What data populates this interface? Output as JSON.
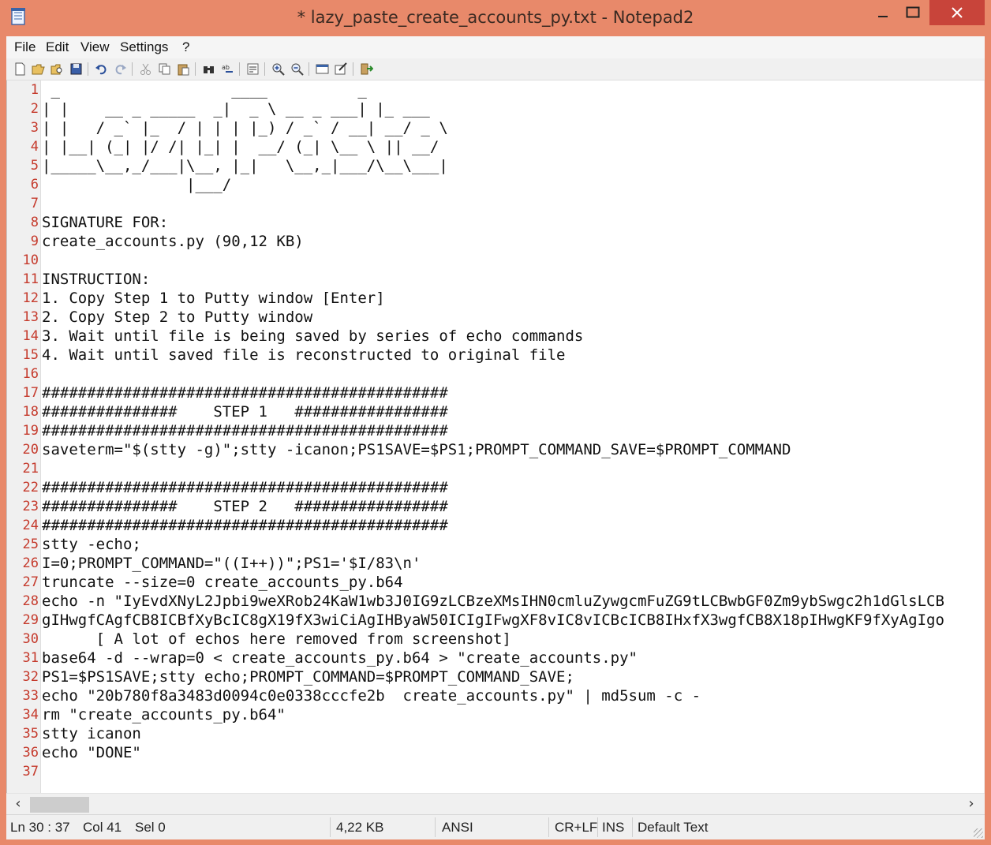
{
  "window": {
    "title": "* lazy_paste_create_accounts_py.txt - Notepad2"
  },
  "menu": [
    "File",
    "Edit",
    "View",
    "Settings",
    "?"
  ],
  "toolbar": {
    "icons": [
      "new-icon",
      "open-icon",
      "browse-icon",
      "save-icon",
      "undo-icon",
      "redo-icon",
      "cut-icon",
      "copy-icon",
      "paste-icon",
      "find-icon",
      "replace-icon",
      "word-wrap-icon",
      "zoom-in-icon",
      "zoom-out-icon",
      "scheme-icon",
      "customize-icon",
      "exit-icon"
    ]
  },
  "editor": {
    "lines": [
      " _                   ____          _",
      "| |    __ _ _____  _|  _ \\ __ _ ___| |_ ___",
      "| |   / _` |_  / | | | |_) / _` / __| __/ _ \\",
      "| |__| (_| |/ /| |_| |  __/ (_| \\__ \\ || __/",
      "|_____\\__,_/___|\\__, |_|   \\__,_|___/\\__\\___|",
      "                |___/",
      "",
      "SIGNATURE FOR:",
      "create_accounts.py (90,12 KB)",
      "",
      "INSTRUCTION:",
      "1. Copy Step 1 to Putty window [Enter]",
      "2. Copy Step 2 to Putty window",
      "3. Wait until file is being saved by series of echo commands",
      "4. Wait until saved file is reconstructed to original file",
      "",
      "#############################################",
      "###############    STEP 1   #################",
      "#############################################",
      "saveterm=\"$(stty -g)\";stty -icanon;PS1SAVE=$PS1;PROMPT_COMMAND_SAVE=$PROMPT_COMMAND",
      "",
      "#############################################",
      "###############    STEP 2   #################",
      "#############################################",
      "stty -echo;",
      "I=0;PROMPT_COMMAND=\"((I++))\";PS1='$I/83\\n'",
      "truncate --size=0 create_accounts_py.b64",
      "echo -n \"IyEvdXNyL2Jpbi9weXRob24KaW1wb3J0IG9zLCBzeXMsIHN0cmluZywgcmFuZG9tLCBwbGF0Zm9ybSwgc2h1dGlsLCB",
      "gIHwgfCAgfCB8ICBfXyBcIC8gX19fX3wiCiAgIHByaW50ICIgIFwgXF8vIC8vICBcICB8IHxfX3wgfCB8X18pIHwgKF9fXyAgIgo",
      "      [ A lot of echos here removed from screenshot]",
      "base64 -d --wrap=0 < create_accounts_py.b64 > \"create_accounts.py\"",
      "PS1=$PS1SAVE;stty echo;PROMPT_COMMAND=$PROMPT_COMMAND_SAVE;",
      "echo \"20b780f8a3483d0094c0e0338cccfe2b  create_accounts.py\" | md5sum -c -",
      "rm \"create_accounts_py.b64\"",
      "stty icanon",
      "echo \"DONE\"",
      ""
    ]
  },
  "status": {
    "position": "Ln 30 : 37",
    "col": "Col 41",
    "sel": "Sel 0",
    "size": "4,22 KB",
    "encoding": "ANSI",
    "eol": "CR+LF",
    "mode": "INS",
    "scheme": "Default Text"
  },
  "colors": {
    "titlebar": "#e8896a",
    "close": "#c8443a",
    "line_numbers": "#c53a2c"
  }
}
